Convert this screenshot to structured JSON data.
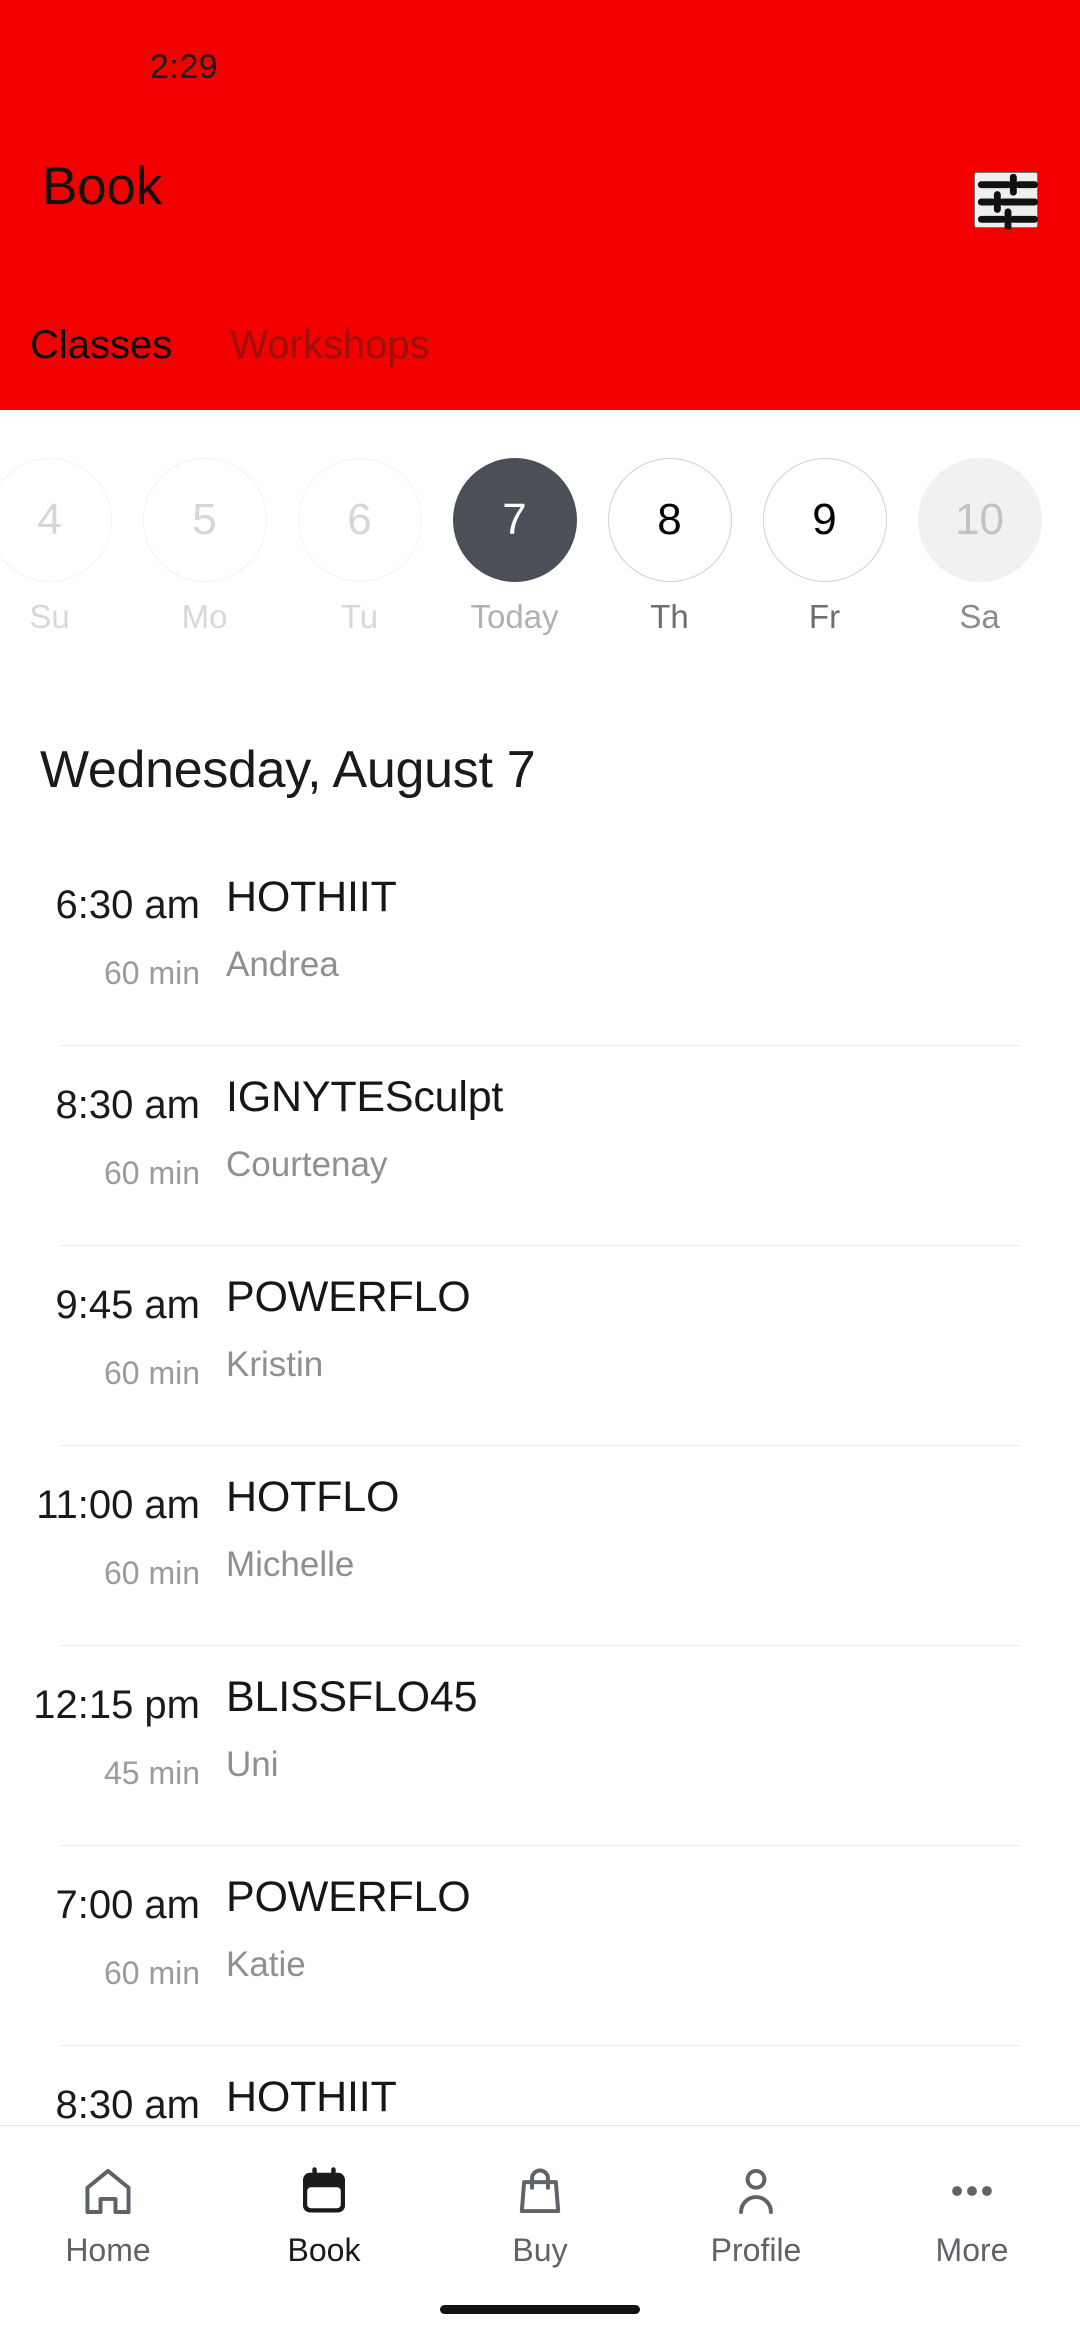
{
  "status_bar": {
    "time": "2:29"
  },
  "header": {
    "title": "Book",
    "filter_icon": "tune-icon",
    "background_color": "#f20000",
    "tabs": [
      {
        "label": "Classes",
        "active": true
      },
      {
        "label": "Workshops",
        "active": false
      }
    ]
  },
  "date_strip": {
    "days": [
      {
        "num": "4",
        "dow": "Su",
        "state": "disabled"
      },
      {
        "num": "5",
        "dow": "Mo",
        "state": "disabled"
      },
      {
        "num": "6",
        "dow": "Tu",
        "state": "disabled"
      },
      {
        "num": "7",
        "dow": "Today",
        "state": "selected"
      },
      {
        "num": "8",
        "dow": "Th",
        "state": "enabled"
      },
      {
        "num": "9",
        "dow": "Fr",
        "state": "enabled"
      },
      {
        "num": "10",
        "dow": "Sa",
        "state": "muted"
      }
    ],
    "selected_color": "#4b4f58"
  },
  "schedule": {
    "day_heading": "Wednesday, August 7",
    "classes": [
      {
        "time": "6:30 am",
        "duration": "60 min",
        "name": "HOTHIIT",
        "teacher": "Andrea"
      },
      {
        "time": "8:30 am",
        "duration": "60 min",
        "name": "IGNYTESculpt",
        "teacher": "Courtenay"
      },
      {
        "time": "9:45 am",
        "duration": "60 min",
        "name": "POWERFLO",
        "teacher": "Kristin"
      },
      {
        "time": "11:00 am",
        "duration": "60 min",
        "name": "HOTFLO",
        "teacher": "Michelle"
      },
      {
        "time": "12:15 pm",
        "duration": "45 min",
        "name": "BLISSFLO45",
        "teacher": "Uni"
      },
      {
        "time": "7:00 am",
        "duration": "60 min",
        "name": "POWERFLO",
        "teacher": "Katie"
      },
      {
        "time": "8:30 am",
        "duration": "",
        "name": "HOTHIIT",
        "teacher": ""
      }
    ]
  },
  "bottom_nav": {
    "items": [
      {
        "label": "Home",
        "icon": "home-icon",
        "active": false
      },
      {
        "label": "Book",
        "icon": "calendar-icon",
        "active": true
      },
      {
        "label": "Buy",
        "icon": "bag-icon",
        "active": false
      },
      {
        "label": "Profile",
        "icon": "person-icon",
        "active": false
      },
      {
        "label": "More",
        "icon": "ellipsis-icon",
        "active": false
      }
    ]
  }
}
